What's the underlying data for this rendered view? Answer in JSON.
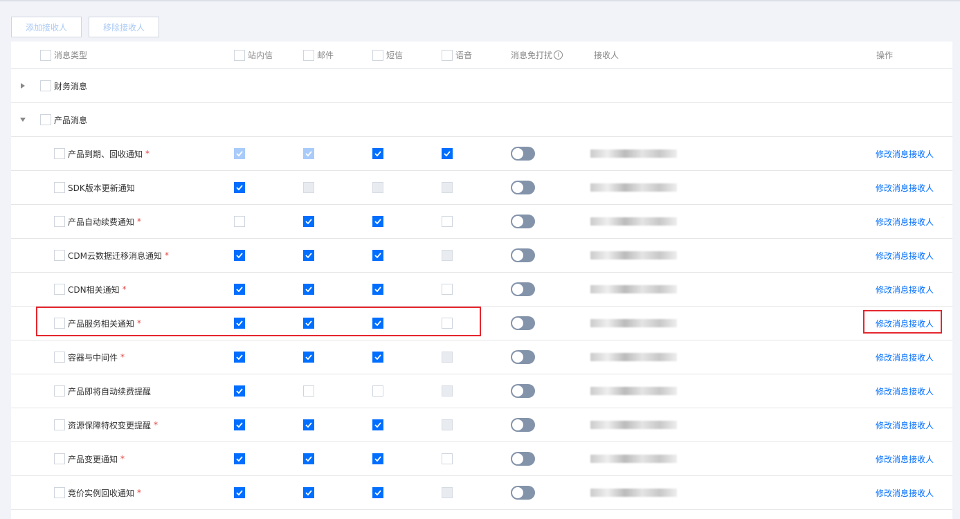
{
  "toolbar": {
    "add_label": "添加接收人",
    "remove_label": "移除接收人"
  },
  "columns": {
    "type": "消息类型",
    "site": "站内信",
    "mail": "邮件",
    "sms": "短信",
    "voice": "语音",
    "dnd": "消息免打扰",
    "receiver": "接收人",
    "action": "操作"
  },
  "groups": [
    {
      "label": "财务消息",
      "expanded": false
    },
    {
      "label": "产品消息",
      "expanded": true
    }
  ],
  "action_label": "修改消息接收人",
  "colors": {
    "accent": "#006eff",
    "highlight": "#e5262e"
  },
  "rows": [
    {
      "name": "产品到期、回收通知",
      "required": true,
      "channels": [
        "dchecked",
        "dchecked",
        "checked",
        "checked"
      ]
    },
    {
      "name": "SDK版本更新通知",
      "required": false,
      "channels": [
        "checked",
        "disabled",
        "disabled",
        "disabled"
      ]
    },
    {
      "name": "产品自动续费通知",
      "required": true,
      "channels": [
        "unchecked",
        "checked",
        "checked",
        "unchecked"
      ]
    },
    {
      "name": "CDM云数据迁移消息通知",
      "required": true,
      "channels": [
        "checked",
        "checked",
        "checked",
        "disabled"
      ]
    },
    {
      "name": "CDN相关通知",
      "required": true,
      "channels": [
        "checked",
        "checked",
        "checked",
        "unchecked"
      ]
    },
    {
      "name": "产品服务相关通知",
      "required": true,
      "channels": [
        "checked",
        "checked",
        "checked",
        "unchecked"
      ]
    },
    {
      "name": "容器与中间件",
      "required": true,
      "channels": [
        "checked",
        "checked",
        "checked",
        "disabled"
      ]
    },
    {
      "name": "产品即将自动续费提醒",
      "required": false,
      "channels": [
        "checked",
        "unchecked",
        "unchecked",
        "disabled"
      ]
    },
    {
      "name": "资源保障特权变更提醒",
      "required": true,
      "channels": [
        "checked",
        "checked",
        "checked",
        "disabled"
      ]
    },
    {
      "name": "产品变更通知",
      "required": true,
      "channels": [
        "checked",
        "checked",
        "checked",
        "unchecked"
      ]
    },
    {
      "name": "竞价实例回收通知",
      "required": true,
      "channels": [
        "checked",
        "checked",
        "checked",
        "disabled"
      ]
    }
  ]
}
